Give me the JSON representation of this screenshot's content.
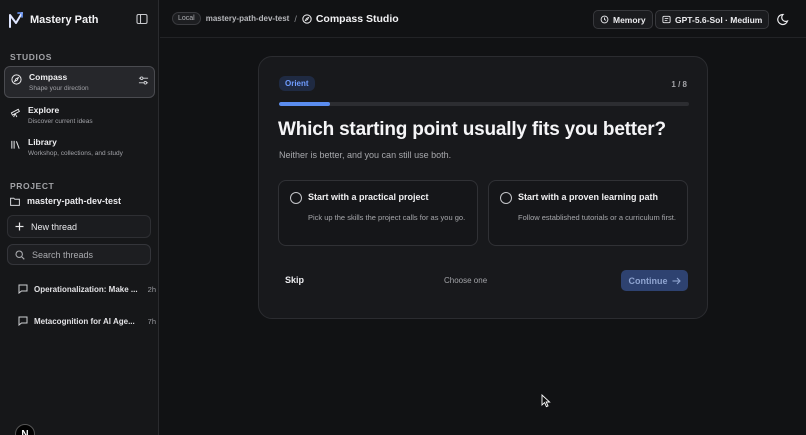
{
  "brand": {
    "name": "Mastery Path"
  },
  "sidebar": {
    "studios_label": "STUDIOS",
    "studios": [
      {
        "title": "Compass",
        "subtitle": "Shape your direction",
        "icon": "compass-icon",
        "active": true
      },
      {
        "title": "Explore",
        "subtitle": "Discover current ideas",
        "icon": "telescope-icon",
        "active": false
      },
      {
        "title": "Library",
        "subtitle": "Workshop, collections, and study",
        "icon": "library-icon",
        "active": false
      }
    ],
    "project_label": "PROJECT",
    "project_name": "mastery-path-dev-test",
    "new_thread_label": "New thread",
    "search_placeholder": "Search threads",
    "threads": [
      {
        "title": "Operationalization: Make ...",
        "time": "2h"
      },
      {
        "title": "Metacognition for AI Age...",
        "time": "7h"
      }
    ],
    "user_initial": "N"
  },
  "header": {
    "badge": "Local",
    "project": "mastery-path-dev-test",
    "separator": "/",
    "current": "Compass Studio",
    "memory_label": "Memory",
    "model_label": "GPT-5.6-Sol · Medium"
  },
  "card": {
    "step_badge": "Orient",
    "step_count": "1 / 8",
    "progress_fraction": 0.125,
    "question": "Which starting point usually fits you better?",
    "subtitle": "Neither is better, and you can still use both.",
    "options": [
      {
        "title": "Start with a practical project",
        "description": "Pick up the skills the project calls for as you go."
      },
      {
        "title": "Start with a proven learning path",
        "description": "Follow established tutorials or a curriculum first."
      }
    ],
    "skip_label": "Skip",
    "hint": "Choose one",
    "continue_label": "Continue"
  },
  "colors": {
    "accent": "#5b8def",
    "background": "#111214",
    "sidebar": "#161719",
    "card": "#18191c"
  }
}
